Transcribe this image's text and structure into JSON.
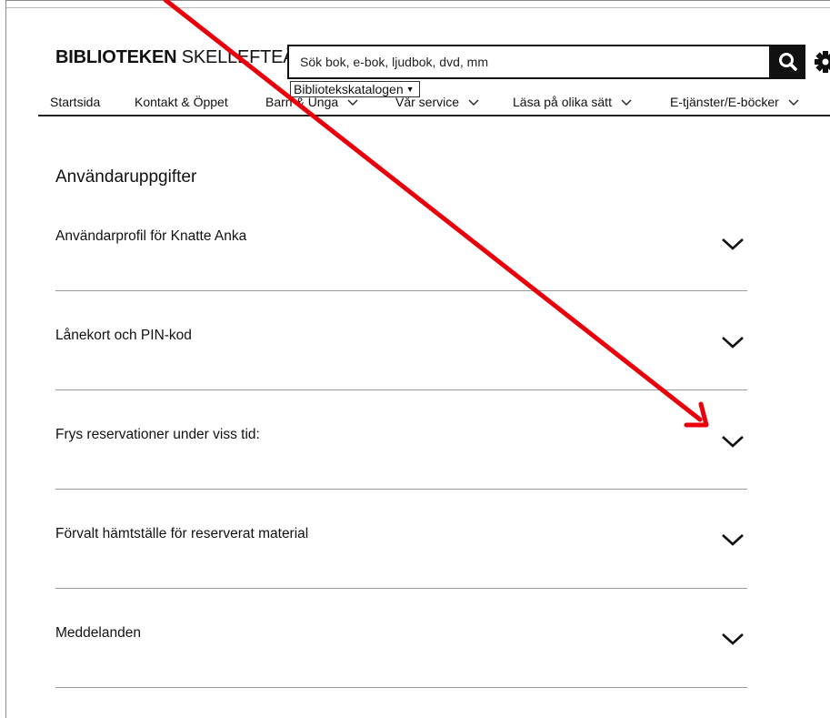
{
  "header": {
    "logo_bold": "BIBLIOTEKEN",
    "logo_light": " SKELLEFTEÅ",
    "search_placeholder": "Sök bok, e-bok, ljudbok, dvd, mm",
    "catalog_select": "Bibliotekskatalogen"
  },
  "nav": {
    "items": [
      {
        "label": "Startsida"
      },
      {
        "label": "Kontakt & Öppet"
      },
      {
        "label": "Barn & Unga"
      },
      {
        "label": "Vår service"
      },
      {
        "label": "Läsa på olika sätt"
      },
      {
        "label": "E-tjänster/E-böcker"
      }
    ]
  },
  "main": {
    "title": "Användaruppgifter",
    "sections": [
      {
        "label": "Användarprofil för Knatte Anka"
      },
      {
        "label": "Lånekort och PIN-kod"
      },
      {
        "label": "Frys reservationer under viss tid:"
      },
      {
        "label": "Förvalt hämtställe för reserverat material"
      },
      {
        "label": "Meddelanden"
      }
    ]
  },
  "icons": {
    "search": "search-icon",
    "settings": "gear-icon",
    "expand": "chevron-down-icon",
    "annotation": "red-arrow-icon"
  },
  "colors": {
    "text": "#111111",
    "annotation_arrow": "#e8000b"
  }
}
